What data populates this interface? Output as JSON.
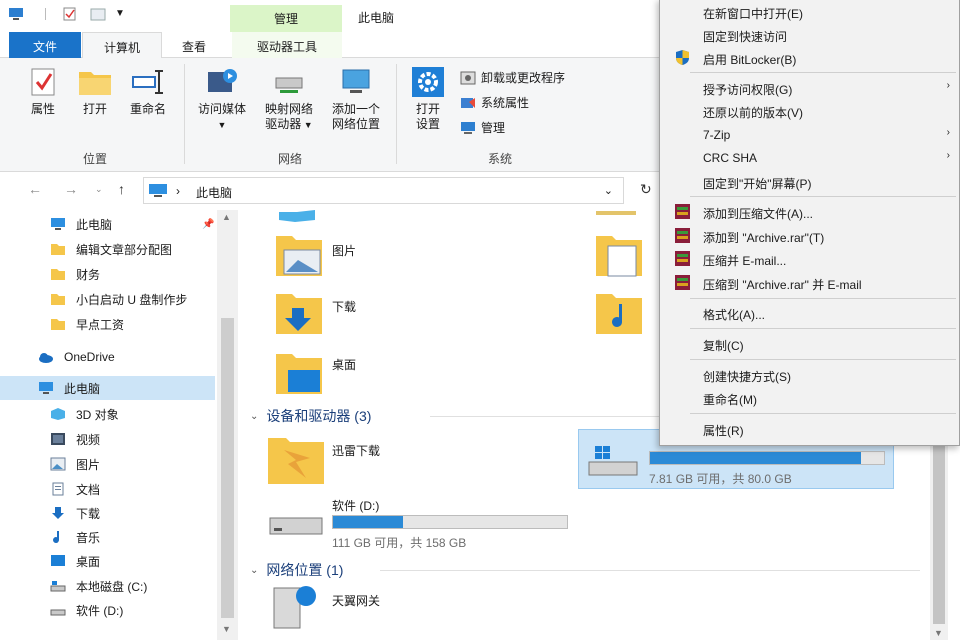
{
  "titlebar": {
    "manage_tab": "管理",
    "window_title": "此电脑"
  },
  "tabs": {
    "file": "文件",
    "computer": "计算机",
    "view": "查看",
    "drive_tools": "驱动器工具"
  },
  "ribbon": {
    "location": {
      "properties": "属性",
      "open": "打开",
      "rename": "重命名",
      "group": "位置"
    },
    "network": {
      "media_line1": "访问媒体",
      "map_line1": "映射网络",
      "map_line2": "驱动器",
      "add_line1": "添加一个",
      "add_line2": "网络位置",
      "group": "网络"
    },
    "system": {
      "settings_line1": "打开",
      "settings_line2": "设置",
      "uninstall": "卸载或更改程序",
      "sysprops": "系统属性",
      "manage": "管理",
      "group": "系统"
    }
  },
  "address": {
    "path": "此电脑"
  },
  "nav_pane": {
    "items": [
      {
        "label": "此电脑"
      },
      {
        "label": "编辑文章部分配图"
      },
      {
        "label": "财务"
      },
      {
        "label": "小白启动 U 盘制作步"
      },
      {
        "label": "早点工资"
      },
      {
        "label": "OneDrive"
      },
      {
        "label": "此电脑"
      },
      {
        "label": "3D 对象"
      },
      {
        "label": "视频"
      },
      {
        "label": "图片"
      },
      {
        "label": "文档"
      },
      {
        "label": "下载"
      },
      {
        "label": "音乐"
      },
      {
        "label": "桌面"
      },
      {
        "label": "本地磁盘 (C:)"
      },
      {
        "label": "软件 (D:)"
      }
    ]
  },
  "content": {
    "folders": [
      {
        "label": "图片"
      },
      {
        "label": "下载"
      },
      {
        "label": "桌面"
      }
    ],
    "devices_header": "设备和驱动器 (3)",
    "devices": [
      {
        "name": "迅雷下载"
      },
      {
        "name": "软件 (D:)",
        "info": "111 GB 可用，共 158 GB",
        "used_fraction": 0.3
      },
      {
        "name": "",
        "info": "7.81 GB 可用，共 80.0 GB",
        "used_fraction": 0.9
      }
    ],
    "network_header": "网络位置 (1)",
    "network_items": [
      {
        "label": "天翼网关"
      }
    ]
  },
  "context_menu": {
    "items": [
      {
        "label": "在新窗口中打开(E)"
      },
      {
        "label": "固定到快速访问"
      },
      {
        "label": "启用 BitLocker(B)"
      },
      {
        "label": "授予访问权限(G)"
      },
      {
        "label": "还原以前的版本(V)"
      },
      {
        "label": "7-Zip"
      },
      {
        "label": "CRC SHA"
      },
      {
        "label": "固定到\"开始\"屏幕(P)"
      },
      {
        "label": "添加到压缩文件(A)..."
      },
      {
        "label": "添加到 \"Archive.rar\"(T)"
      },
      {
        "label": "压缩并 E-mail..."
      },
      {
        "label": "压缩到 \"Archive.rar\" 并 E-mail"
      },
      {
        "label": "格式化(A)..."
      },
      {
        "label": "复制(C)"
      },
      {
        "label": "创建快捷方式(S)"
      },
      {
        "label": "重命名(M)"
      },
      {
        "label": "属性(R)"
      }
    ]
  },
  "colors": {
    "accent": "#1a73c9",
    "drive_fill": "#2b8ad6",
    "context_tab": "#dbf5c8",
    "folder": "#f5c64a"
  }
}
